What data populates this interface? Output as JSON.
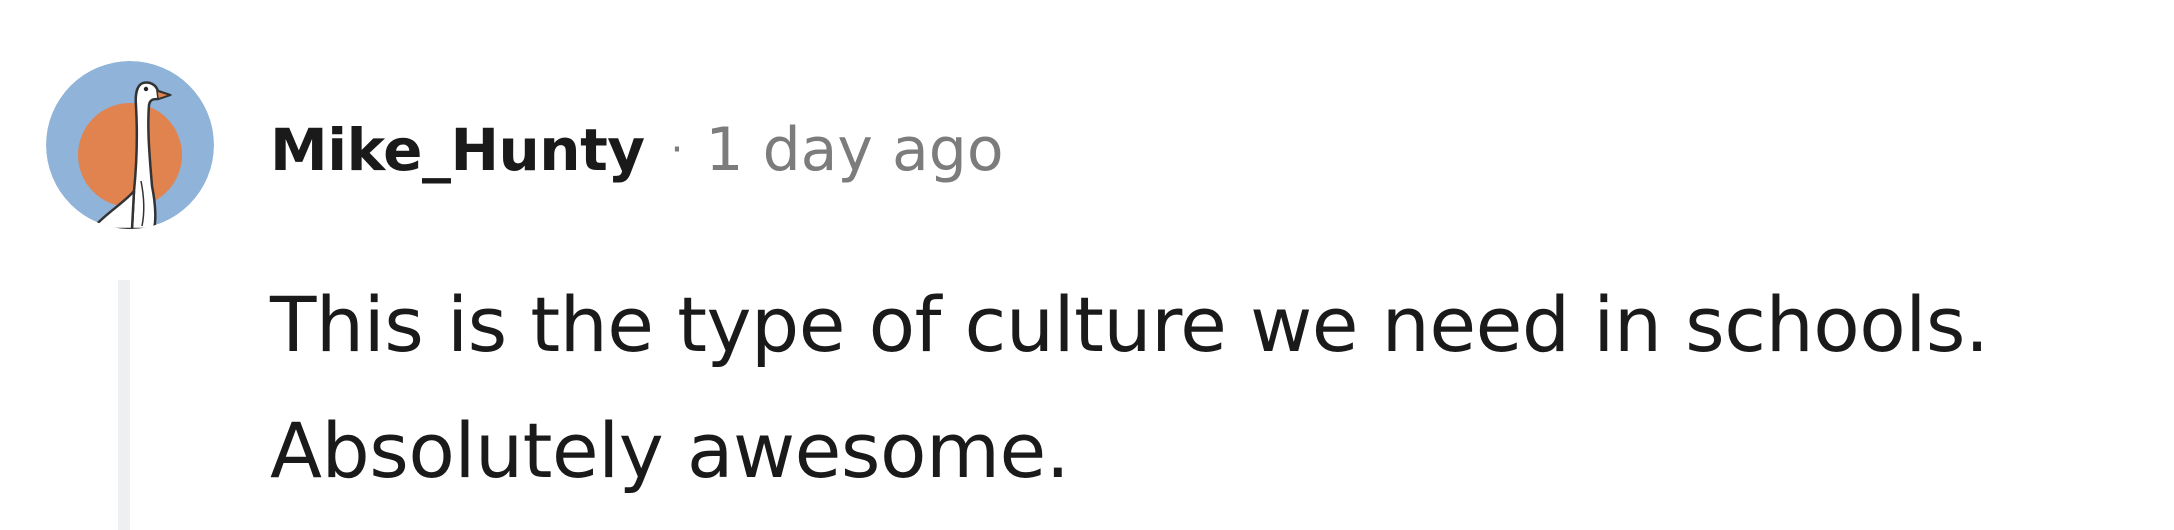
{
  "comment": {
    "author": "Mike_Hunty",
    "separator": "·",
    "timestamp": "1 day ago",
    "body_lines": [
      "This is the type of culture we need in schools.",
      "Absolutely awesome."
    ],
    "avatar": {
      "icon": "goose-icon",
      "background_color": "#8fb3d9",
      "sun_color": "#e0834f"
    }
  }
}
